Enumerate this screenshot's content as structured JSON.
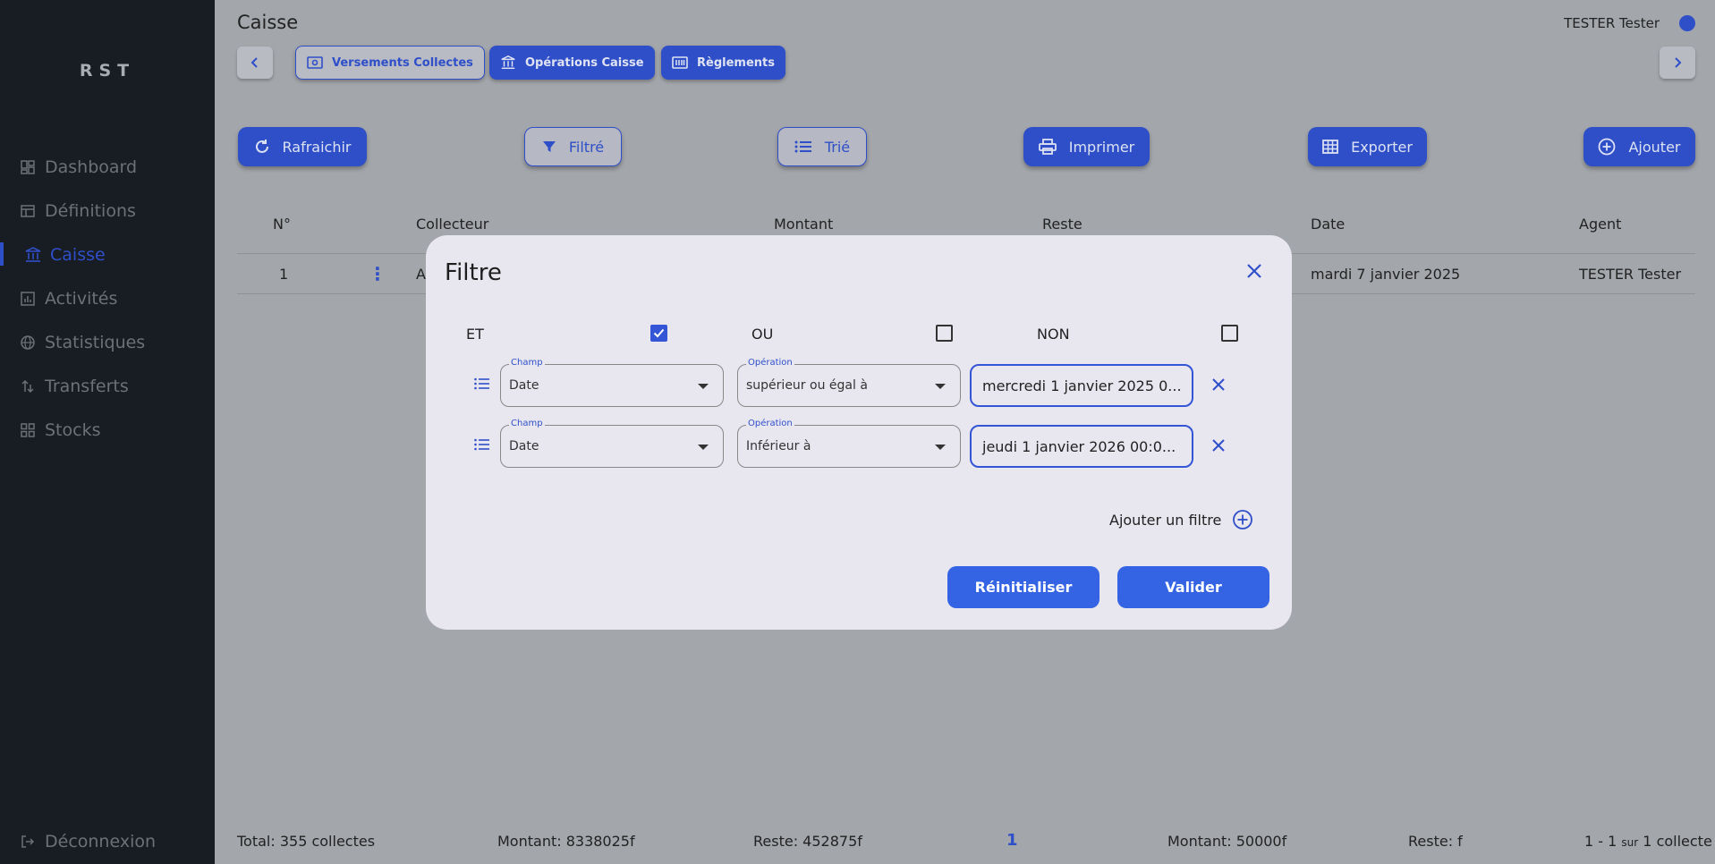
{
  "app": {
    "logo": "RST"
  },
  "sidebar": {
    "items": [
      {
        "label": "Dashboard",
        "icon": "dashboard-icon"
      },
      {
        "label": "Définitions",
        "icon": "table-icon"
      },
      {
        "label": "Caisse",
        "icon": "bank-icon",
        "active": true
      },
      {
        "label": "Activités",
        "icon": "chart-icon"
      },
      {
        "label": "Statistiques",
        "icon": "globe-icon"
      },
      {
        "label": "Transferts",
        "icon": "transfer-icon"
      },
      {
        "label": "Stocks",
        "icon": "grid-icon"
      }
    ],
    "logout": "Déconnexion"
  },
  "header": {
    "title": "Caisse",
    "user": "TESTER Tester"
  },
  "chips": [
    {
      "label": "Versements Collectes",
      "icon": "cash-icon"
    },
    {
      "label": "Opérations Caisse",
      "icon": "bank-icon"
    },
    {
      "label": "Règlements",
      "icon": "barcode-icon"
    }
  ],
  "toolbar": {
    "refresh": "Rafraichir",
    "filter": "Filtré",
    "sort": "Trié",
    "print": "Imprimer",
    "export": "Exporter",
    "add": "Ajouter"
  },
  "table": {
    "columns": [
      "N°",
      "Collecteur",
      "Montant",
      "Reste",
      "Date",
      "Agent"
    ],
    "rows": [
      {
        "num": "1",
        "collecteur": "A",
        "date": "mardi 7 janvier 2025",
        "agent": "TESTER Tester"
      }
    ]
  },
  "footer": {
    "total": "Total: 355 collectes",
    "montant": "Montant: 8338025f",
    "reste": "Reste: 452875f",
    "page": "1",
    "montant_page": "Montant: 50000f",
    "reste_page": "Reste: f",
    "range_start": "1 - 1",
    "range_sur": "sur",
    "range_end": "1 collecte"
  },
  "modal": {
    "title": "Filtre",
    "logic": {
      "et": "ET",
      "ou": "OU",
      "non": "NON",
      "et_checked": true,
      "ou_checked": false,
      "non_checked": false
    },
    "filters": [
      {
        "champ_label": "Champ",
        "champ": "Date",
        "operation_label": "Opération",
        "operation": "supérieur ou égal à",
        "value": "mercredi 1 janvier 2025 0..."
      },
      {
        "champ_label": "Champ",
        "champ": "Date",
        "operation_label": "Opération",
        "operation": "Inférieur à",
        "value": "jeudi 1 janvier 2026 00:0..."
      }
    ],
    "add_filter": "Ajouter un filtre",
    "reset": "Réinitialiser",
    "validate": "Valider"
  },
  "colors": {
    "accent": "#2f4fc9",
    "button": "#3464e4",
    "sidebar": "#181d24",
    "overlay": "#a3a6ab",
    "modal": "#e8e7f0"
  }
}
